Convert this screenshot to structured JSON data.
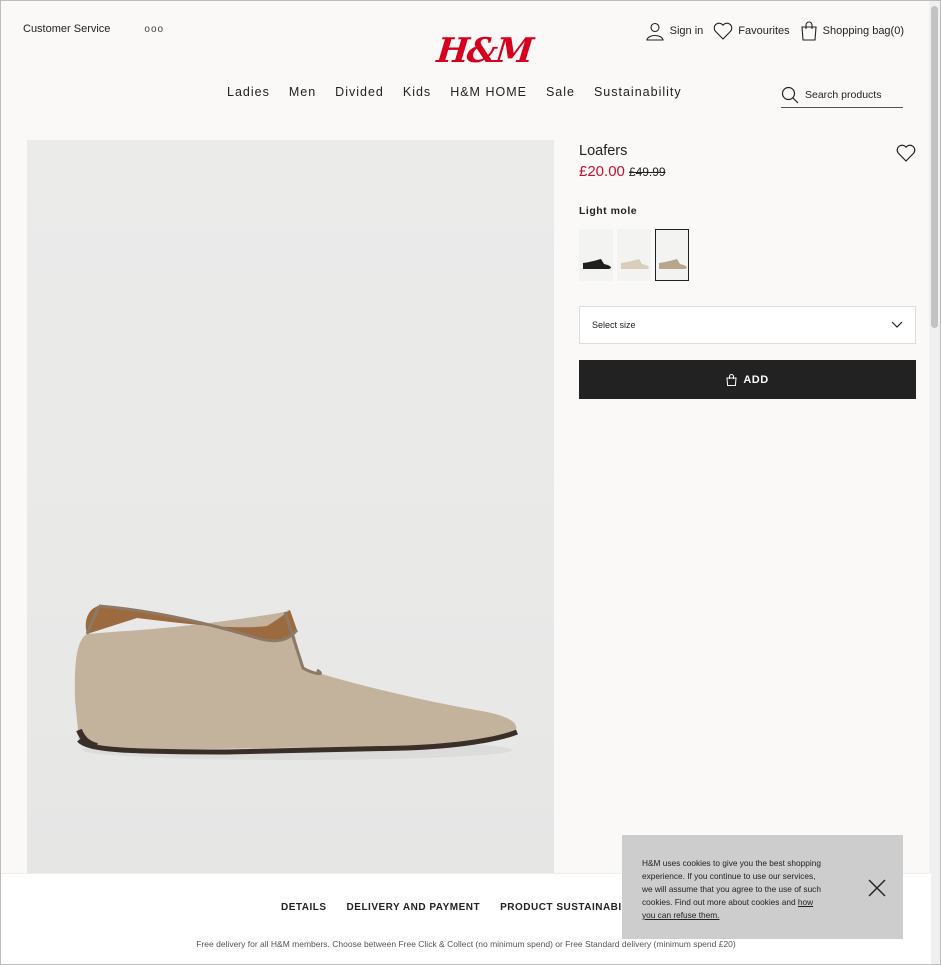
{
  "header": {
    "customer_service": "Customer Service",
    "more": "ooo",
    "logo": "H&M",
    "sign_in": "Sign in",
    "favourites": "Favourites",
    "shopping_bag": "Shopping bag(0)"
  },
  "nav": {
    "items": [
      "Ladies",
      "Men",
      "Divided",
      "Kids",
      "H&M HOME",
      "Sale",
      "Sustainability"
    ],
    "search_placeholder": "Search products"
  },
  "product": {
    "name": "Loafers",
    "price_now": "£20.00",
    "price_was": "£49.99",
    "color_label": "Light mole",
    "swatches": [
      {
        "icon": "black-loafer-thumb",
        "color": "#1e1e1e"
      },
      {
        "icon": "beige-loafer-thumb",
        "color": "#d9cdbb"
      },
      {
        "icon": "mole-loafer-thumb",
        "color": "#b8a58c",
        "selected": true
      }
    ],
    "size_select": "Select size",
    "add_button": "ADD",
    "shoe_color": "#c4b39c"
  },
  "footer": {
    "tabs": [
      "DETAILS",
      "DELIVERY AND PAYMENT",
      "PRODUCT SUSTAINABILITY"
    ],
    "delivery_note": "Free delivery for all H&M members. Choose between Free Click & Collect (no minimum spend) or Free Standard delivery (minimum spend £20)"
  },
  "cookie": {
    "text": "H&M uses cookies to give you the best shopping experience. If you continue to use our services, we will assume that you agree to the use of such cookies. Find out more about cookies and",
    "link": "how you can refuse them."
  },
  "colors": {
    "brand_red": "#d6001c",
    "price_red": "#c8102e",
    "add_button_bg": "#222222"
  }
}
